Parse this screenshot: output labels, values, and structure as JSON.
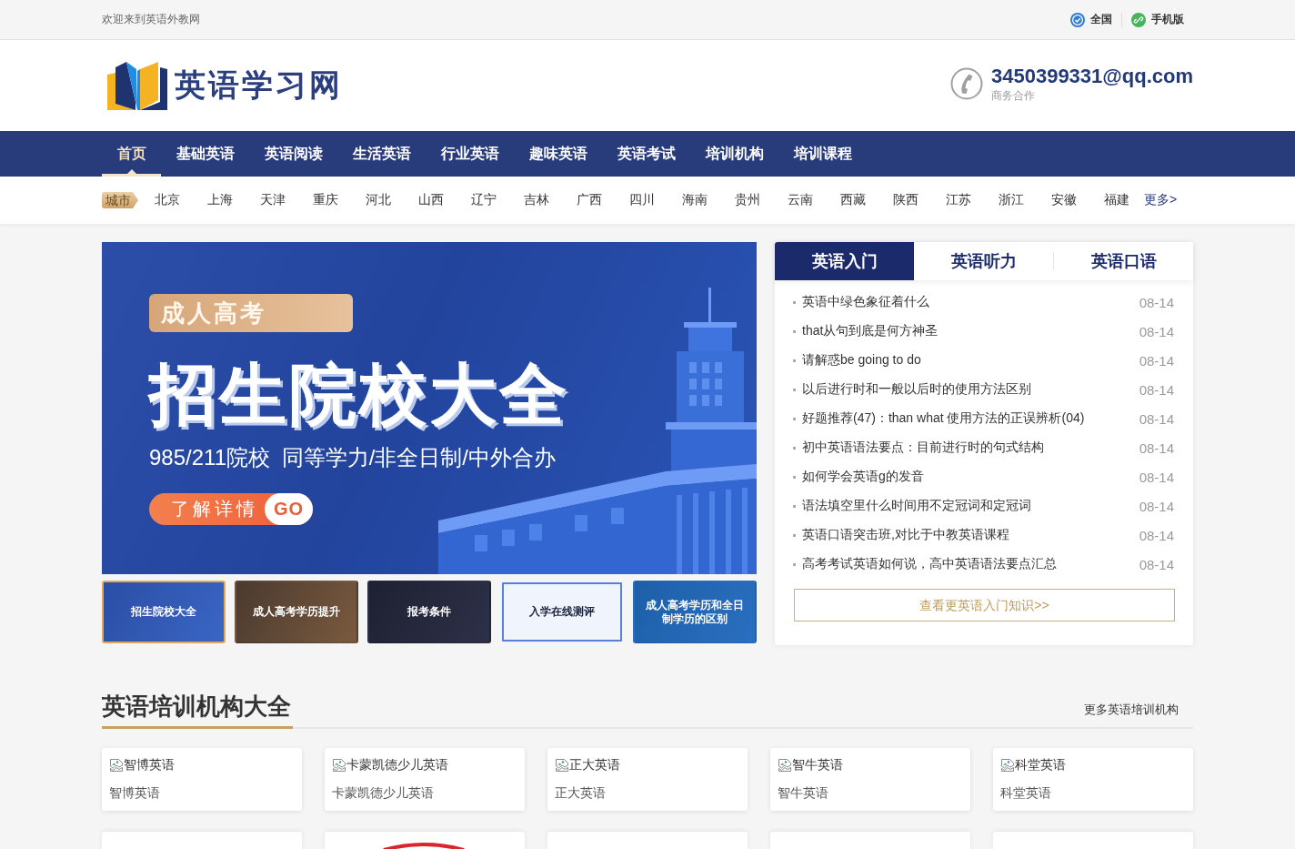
{
  "top_bar": {
    "welcome": "欢迎来到英语外教网",
    "links": [
      {
        "kind": "region",
        "label": "全国"
      },
      {
        "kind": "mobile",
        "label": "手机版"
      }
    ]
  },
  "header": {
    "logo_text": "英语学习网",
    "contact": {
      "email": "3450399331@qq.com",
      "caption": "商务合作"
    }
  },
  "nav_items": [
    {
      "label": "首页",
      "selected": true
    },
    {
      "label": "基础英语",
      "selected": false
    },
    {
      "label": "英语阅读",
      "selected": false
    },
    {
      "label": "生活英语",
      "selected": false
    },
    {
      "label": "行业英语",
      "selected": false
    },
    {
      "label": "趣味英语",
      "selected": false
    },
    {
      "label": "英语考试",
      "selected": false
    },
    {
      "label": "培训机构",
      "selected": false
    },
    {
      "label": "培训课程",
      "selected": false
    }
  ],
  "city_bar": {
    "tag": "城市",
    "cities": [
      "北京",
      "上海",
      "天津",
      "重庆",
      "河北",
      "山西",
      "辽宁",
      "吉林",
      "广西",
      "四川",
      "海南",
      "贵州",
      "云南",
      "西藏",
      "陕西",
      "江苏",
      "浙江",
      "安徽",
      "福建"
    ],
    "more": "更多>"
  },
  "banner": {
    "tag": "成人高考",
    "headline": "招生院校大全",
    "subtitle": "985/211院校 同等学力/非全日制/中外合办",
    "button": "了解详情",
    "button_badge": "GO"
  },
  "banner_thumbnails": [
    {
      "title": "招生院校大全",
      "selected": true
    },
    {
      "title": "成人高考学历提升",
      "selected": false
    },
    {
      "title": "报考条件",
      "selected": false
    },
    {
      "title": "入学在线测评",
      "selected": false
    },
    {
      "title": "成人高考学历和全日制学历的区别",
      "selected": false
    }
  ],
  "news_panel": {
    "tabs": [
      {
        "label": "英语入门",
        "selected": true
      },
      {
        "label": "英语听力",
        "selected": false
      },
      {
        "label": "英语口语",
        "selected": false
      }
    ],
    "items": [
      {
        "title": "英语中绿色象征着什么",
        "date": "08-14"
      },
      {
        "title": "that从句到底是何方神圣",
        "date": "08-14"
      },
      {
        "title": "请解惑be going to do",
        "date": "08-14"
      },
      {
        "title": "以后进行时和一般以后时的使用方法区别",
        "date": "08-14"
      },
      {
        "title": "好题推荐(47)：than what 使用方法的正误辨析(04)",
        "date": "08-14"
      },
      {
        "title": "初中英语语法要点：目前进行时的句式结构",
        "date": "08-14"
      },
      {
        "title": "如何学会英语g的发音",
        "date": "08-14"
      },
      {
        "title": "语法填空里什么时间用不定冠词和定冠词",
        "date": "08-14"
      },
      {
        "title": "英语口语突击班,对比于中教英语课程",
        "date": "08-14"
      },
      {
        "title": "高考考试英语如何说，高中英语语法要点汇总",
        "date": "08-14"
      }
    ],
    "more_button": "查看更英语入门知识>>"
  },
  "institutions": {
    "title": "英语培训机构大全",
    "more": "更多英语培训机构",
    "cards": [
      {
        "image_alt": "智博英语",
        "name": "智博英语"
      },
      {
        "image_alt": "卡蒙凯德少儿英语",
        "name": "卡蒙凯德少儿英语"
      },
      {
        "image_alt": "正大英语",
        "name": "正大英语"
      },
      {
        "image_alt": "智牛英语",
        "name": "智牛英语"
      },
      {
        "image_alt": "科堂英语",
        "name": "科堂英语"
      }
    ],
    "next_row": [
      {
        "kind": "image"
      },
      {
        "kind": "logo"
      },
      {
        "kind": "image"
      },
      {
        "kind": "image"
      },
      {
        "kind": "image"
      }
    ]
  }
}
